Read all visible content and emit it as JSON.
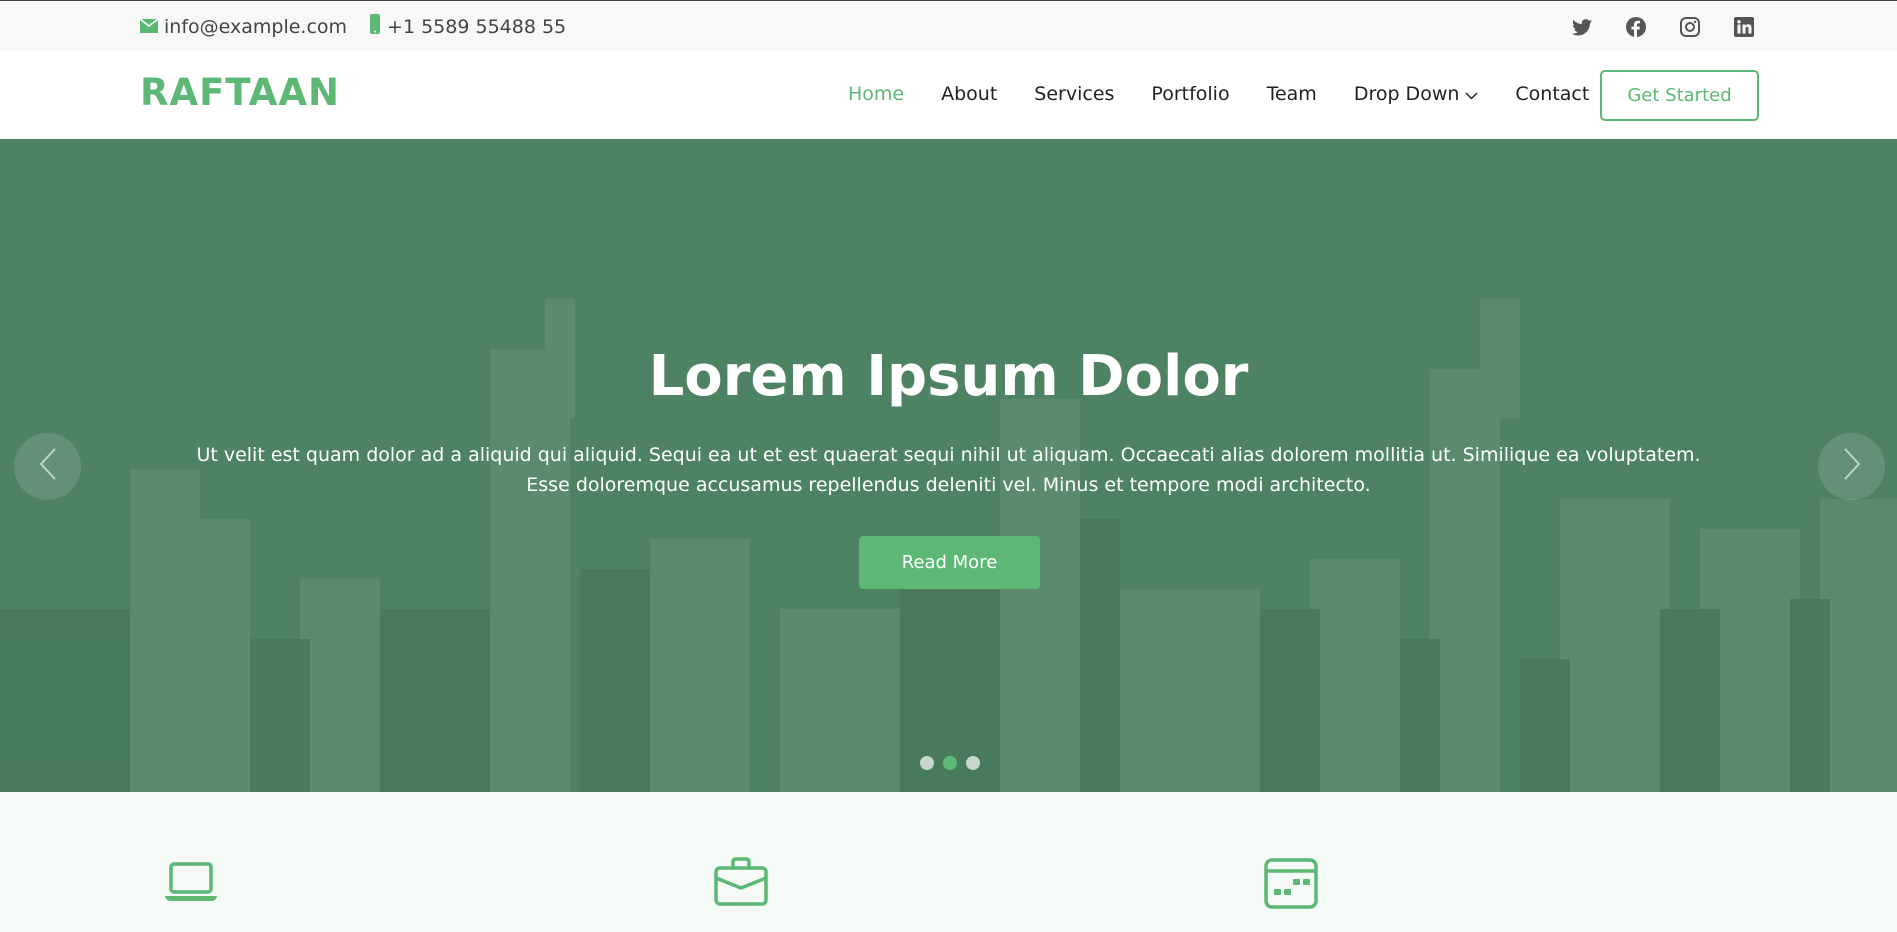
{
  "topbar": {
    "email": "info@example.com",
    "phone": "+1 5589 55488 55",
    "social": [
      "twitter-icon",
      "facebook-icon",
      "instagram-icon",
      "linkedin-icon"
    ]
  },
  "header": {
    "logo": "RAFTAAN",
    "nav": [
      {
        "label": "Home",
        "active": true
      },
      {
        "label": "About",
        "active": false
      },
      {
        "label": "Services",
        "active": false
      },
      {
        "label": "Portfolio",
        "active": false
      },
      {
        "label": "Team",
        "active": false
      },
      {
        "label": "Drop Down",
        "active": false,
        "dropdown": true
      },
      {
        "label": "Contact",
        "active": false
      }
    ],
    "cta": "Get Started"
  },
  "hero": {
    "title": "Lorem Ipsum Dolor",
    "text": "Ut velit est quam dolor ad a aliquid qui aliquid. Sequi ea ut et est quaerat sequi nihil ut aliquam. Occaecati alias dolorem mollitia ut. Similique ea voluptatem. Esse doloremque accusamus repellendus deleniti vel. Minus et tempore modi architecto.",
    "button": "Read More",
    "slides": 3,
    "active_slide": 2
  },
  "features": {
    "icons": [
      "laptop-icon",
      "briefcase-icon",
      "calendar-icon"
    ]
  },
  "colors": {
    "accent": "#5cb874",
    "hero_overlay": "#4a7d5c",
    "features_bg": "#f4fbf6"
  }
}
